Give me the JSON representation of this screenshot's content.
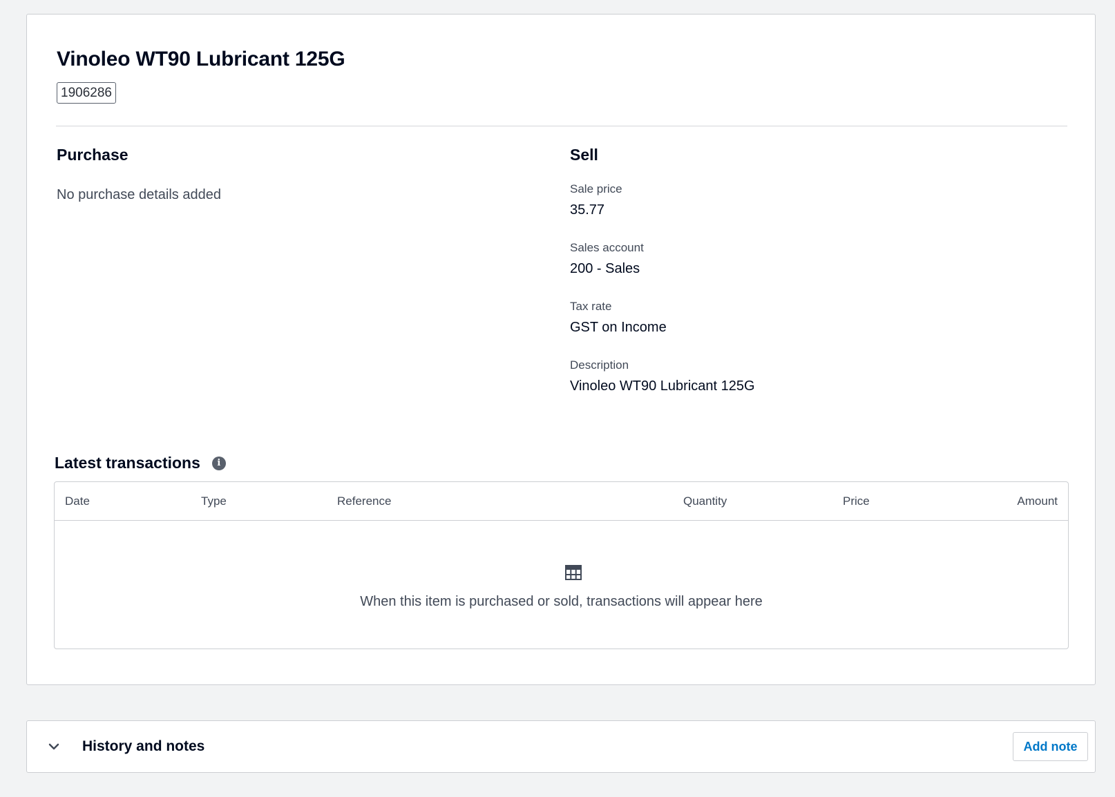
{
  "item": {
    "title": "Vinoleo WT90 Lubricant 125G",
    "code": "1906286"
  },
  "purchase": {
    "heading": "Purchase",
    "empty_text": "No purchase details added"
  },
  "sell": {
    "heading": "Sell",
    "fields": [
      {
        "label": "Sale price",
        "value": "35.77"
      },
      {
        "label": "Sales account",
        "value": "200 - Sales"
      },
      {
        "label": "Tax rate",
        "value": "GST on Income"
      },
      {
        "label": "Description",
        "value": "Vinoleo WT90 Lubricant 125G"
      }
    ]
  },
  "transactions": {
    "heading": "Latest transactions",
    "info_icon": "info-icon",
    "columns": [
      "Date",
      "Type",
      "Reference",
      "Quantity",
      "Price",
      "Amount"
    ],
    "rows": [],
    "empty_icon": "table-grid-icon",
    "empty_text": "When this item is purchased or sold, transactions will appear here"
  },
  "history": {
    "toggle_icon": "chevron-down-icon",
    "title": "History and notes",
    "add_note_label": "Add note"
  },
  "colors": {
    "background": "#f2f3f4",
    "text": "#000a1e",
    "muted_text": "#414957",
    "border": "#ccced2",
    "link_blue": "#0078c8"
  }
}
